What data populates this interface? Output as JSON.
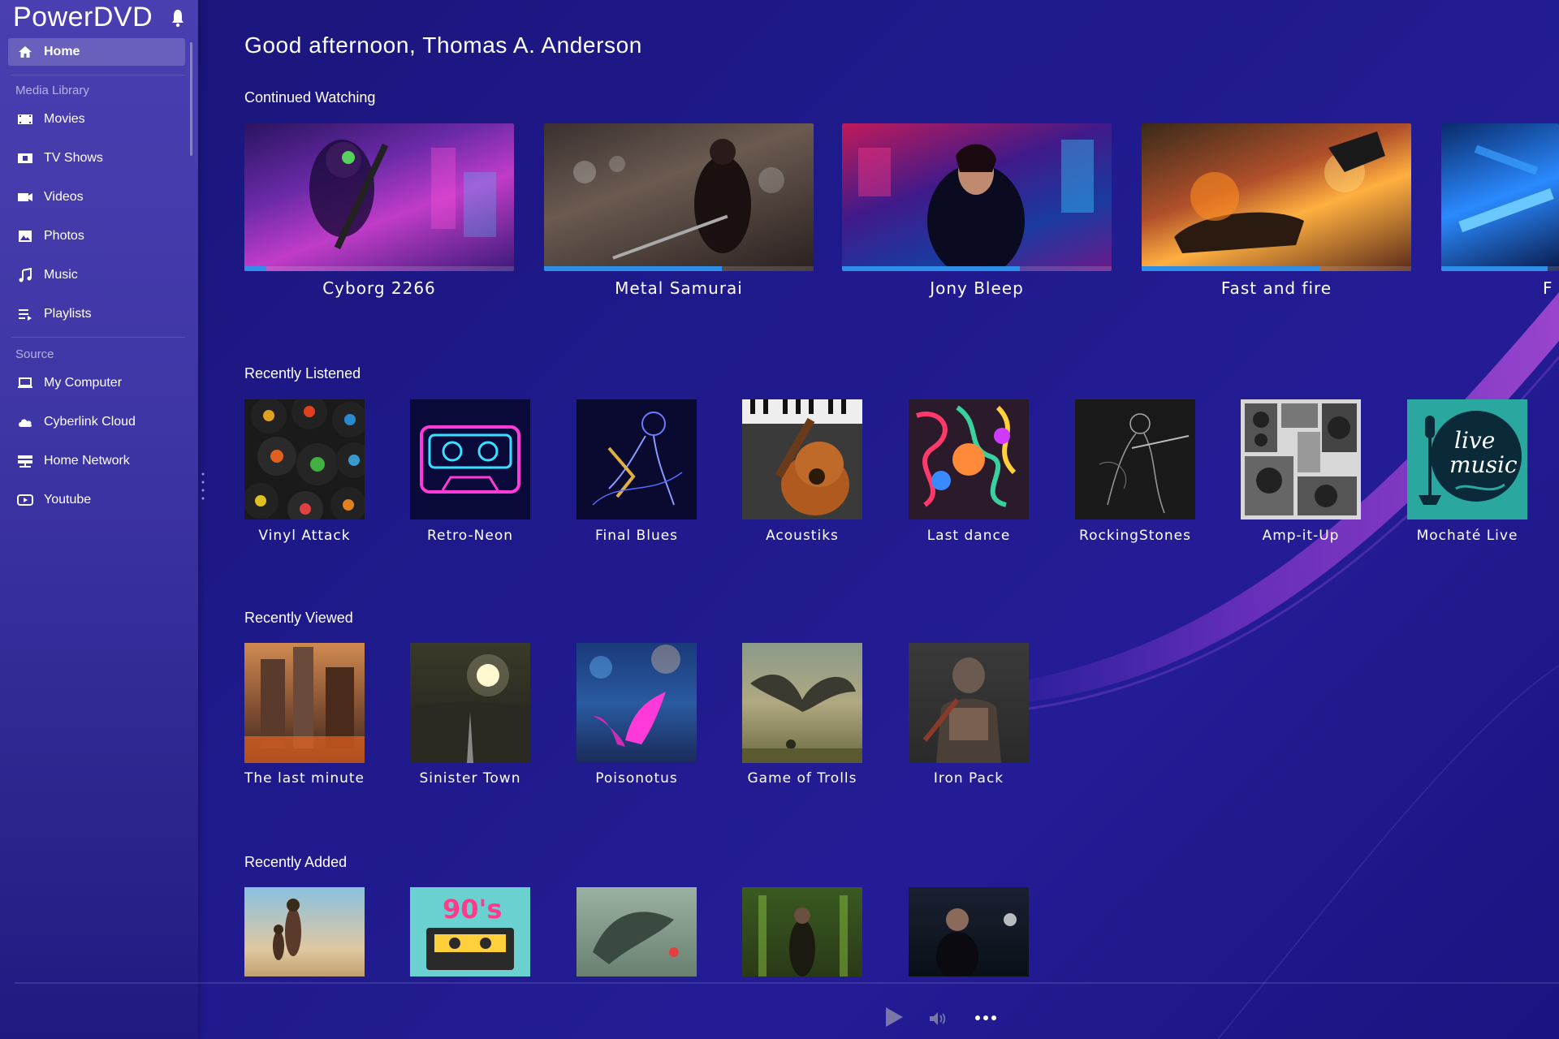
{
  "app": {
    "title": "PowerDVD"
  },
  "sidebar": {
    "home_label": "Home",
    "media_library_label": "Media Library",
    "media_items": [
      {
        "label": "Movies",
        "icon": "film-icon"
      },
      {
        "label": "TV Shows",
        "icon": "tv-icon"
      },
      {
        "label": "Videos",
        "icon": "video-camera-icon"
      },
      {
        "label": "Photos",
        "icon": "photo-icon"
      },
      {
        "label": "Music",
        "icon": "music-note-icon"
      },
      {
        "label": "Playlists",
        "icon": "playlist-icon"
      }
    ],
    "source_label": "Source",
    "source_items": [
      {
        "label": "My Computer",
        "icon": "laptop-icon"
      },
      {
        "label": "Cyberlink Cloud",
        "icon": "cloud-icon"
      },
      {
        "label": "Home Network",
        "icon": "network-icon"
      },
      {
        "label": "Youtube",
        "icon": "youtube-icon"
      }
    ]
  },
  "main": {
    "greeting": "Good afternoon, Thomas A. Anderson",
    "continued_watching": {
      "title": "Continued Watching",
      "items": [
        {
          "title": "Cyborg 2266",
          "progress": 0.08
        },
        {
          "title": "Metal Samurai",
          "progress": 0.66
        },
        {
          "title": "Jony Bleep",
          "progress": 0.66
        },
        {
          "title": "Fast and fire",
          "progress": 0.66
        },
        {
          "title": "F",
          "progress": 0.9
        }
      ]
    },
    "recently_listened": {
      "title": "Recently Listened",
      "items": [
        {
          "title": "Vinyl Attack"
        },
        {
          "title": "Retro-Neon"
        },
        {
          "title": "Final Blues"
        },
        {
          "title": "Acoustiks"
        },
        {
          "title": "Last dance"
        },
        {
          "title": "RockingStones"
        },
        {
          "title": "Amp-it-Up"
        },
        {
          "title": "Mochaté Live",
          "art_text_1": "live",
          "art_text_2": "music"
        }
      ]
    },
    "recently_viewed": {
      "title": "Recently Viewed",
      "items": [
        {
          "title": "The last minute"
        },
        {
          "title": "Sinister Town"
        },
        {
          "title": "Poisonotus"
        },
        {
          "title": "Game of Trolls"
        },
        {
          "title": "Iron Pack"
        }
      ]
    },
    "recently_added": {
      "title": "Recently Added",
      "art_text": "90's"
    }
  },
  "player": {
    "play_icon": "play-icon",
    "volume_icon": "volume-icon",
    "more_icon": "more-icon"
  }
}
